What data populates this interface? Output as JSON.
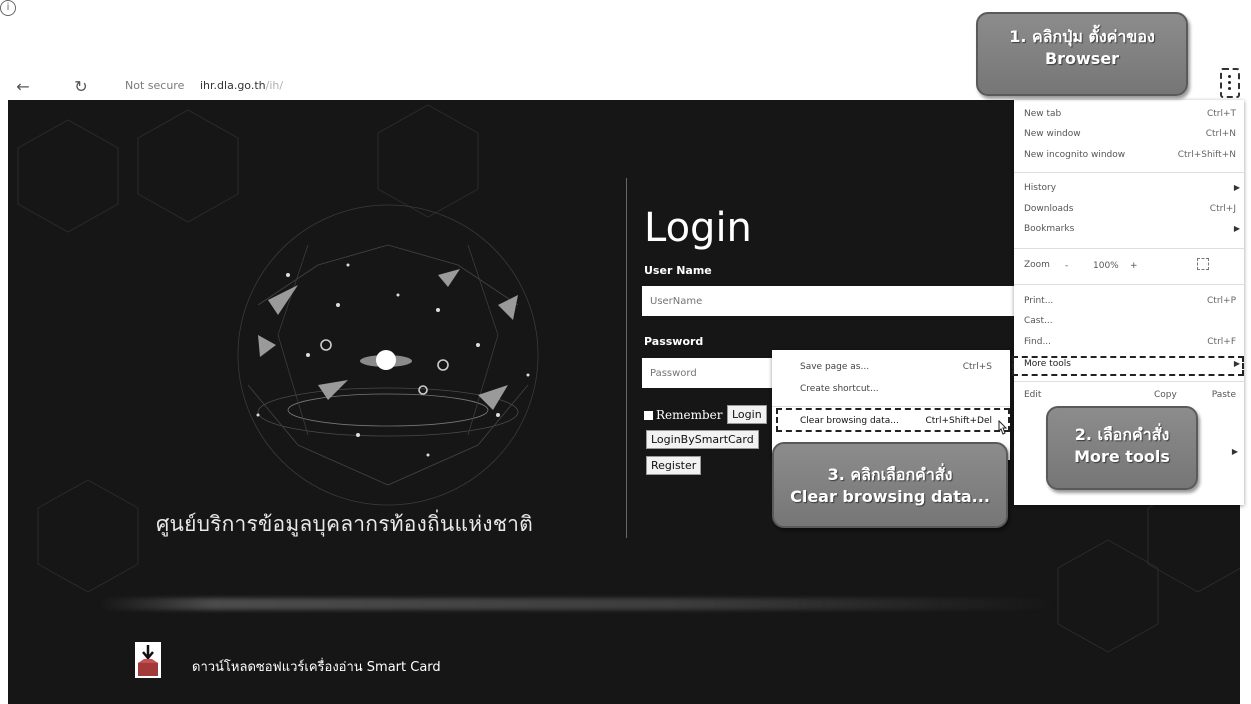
{
  "address_bar": {
    "security_label": "Not secure",
    "host": "ihr.dla.go.th",
    "path": "/ih/"
  },
  "page": {
    "tagline": "ศูนย์บริการข้อมูลบุคลากรท้องถิ่นแห่งชาติ",
    "login": {
      "title": "Login",
      "username_label": "User Name",
      "username_placeholder": "UserName",
      "password_label": "Password",
      "password_placeholder": "Password",
      "remember_label": "Remember",
      "login_button": "Login",
      "smartcard_button": "LoginBySmartCard",
      "register_button": "Register"
    },
    "download_text": "ดาวน์โหลดซอฟแวร์เครื่องอ่าน Smart Card"
  },
  "browser_menu": {
    "items": [
      {
        "label": "New tab",
        "shortcut": "Ctrl+T"
      },
      {
        "label": "New window",
        "shortcut": "Ctrl+N"
      },
      {
        "label": "New incognito window",
        "shortcut": "Ctrl+Shift+N"
      },
      {
        "label": "History",
        "shortcut": ""
      },
      {
        "label": "Downloads",
        "shortcut": "Ctrl+J"
      },
      {
        "label": "Bookmarks",
        "shortcut": ""
      },
      {
        "label": "Zoom",
        "shortcut": ""
      },
      {
        "label": "Print...",
        "shortcut": "Ctrl+P"
      },
      {
        "label": "Cast...",
        "shortcut": ""
      },
      {
        "label": "Find...",
        "shortcut": "Ctrl+F"
      },
      {
        "label": "More tools",
        "shortcut": ""
      },
      {
        "label": "Edit",
        "shortcut": ""
      }
    ],
    "zoom": {
      "minus": "-",
      "value": "100%",
      "plus": "+"
    },
    "edit": {
      "copy": "Copy",
      "paste": "Paste"
    }
  },
  "submenu": {
    "items": [
      {
        "label": "Save page as...",
        "shortcut": "Ctrl+S"
      },
      {
        "label": "Create shortcut...",
        "shortcut": ""
      },
      {
        "label": "Clear browsing data...",
        "shortcut": "Ctrl+Shift+Del"
      }
    ]
  },
  "callouts": {
    "step1_line1": "1. คลิกปุ่ม ตั้งค่าของ",
    "step1_line2": "Browser",
    "step2_line1": "2. เลือกคำสั่ง",
    "step2_line2": "More tools",
    "step3_line1": "3. คลิกเลือกคำสั่ง",
    "step3_line2": "Clear browsing data..."
  },
  "colors": {
    "page_background": "#161616",
    "callout_fill": "#808080",
    "highlight_dash": "#222222"
  }
}
